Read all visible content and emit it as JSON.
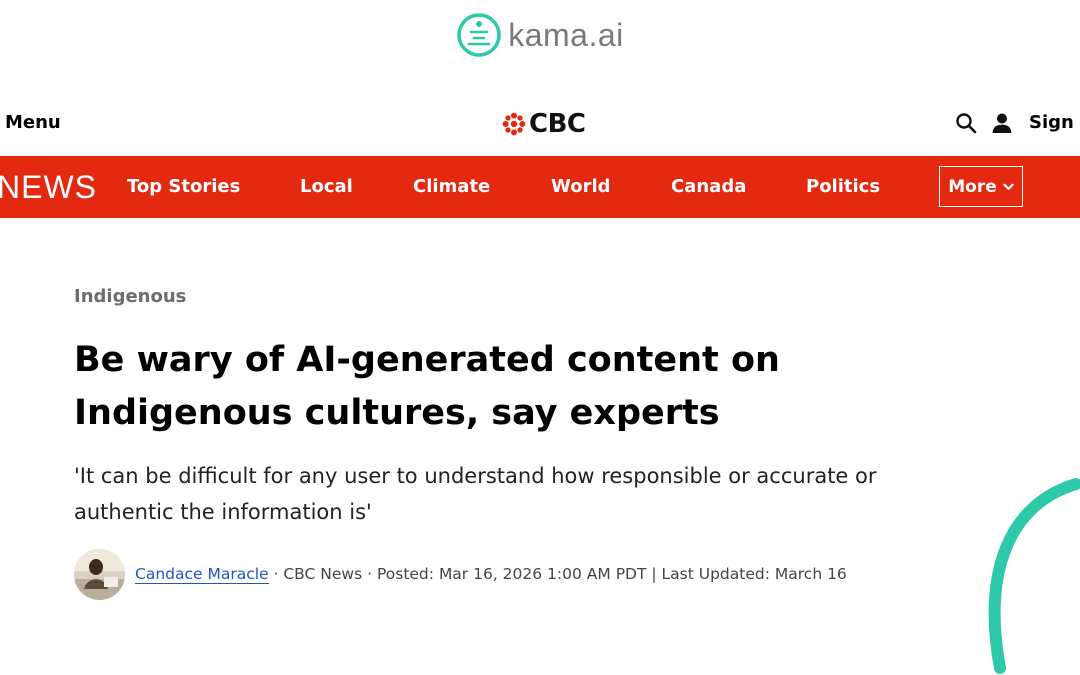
{
  "kama": {
    "brand": "kama.ai",
    "logo_icon": "kama-ai-logo",
    "accent": "#2ec9a8"
  },
  "top_bar": {
    "menu_label": "Menu",
    "cbc_word": "CBC",
    "search_icon": "search-icon",
    "user_icon": "user-icon",
    "sign_in_label": "Sign In"
  },
  "nav": {
    "brand": "NEWS",
    "items": [
      "Top Stories",
      "Local",
      "Climate",
      "World",
      "Canada",
      "Politics"
    ],
    "more_label": "More",
    "color": "#e32910"
  },
  "article": {
    "category": "Indigenous",
    "headline_line1": "Be wary of AI-generated content on",
    "headline_line2": "Indigenous cultures, say experts",
    "dek_line1": "'It can be difficult for any user to understand how responsible or accurate or",
    "dek_line2": "authentic the information is'",
    "author": "Candace Maracle",
    "outlet": "CBC News",
    "posted_label": "Posted:",
    "posted_date": "Mar 16, 2026 1:00 AM PDT",
    "updated_label": "Last Updated:",
    "updated_date": "March 16"
  }
}
